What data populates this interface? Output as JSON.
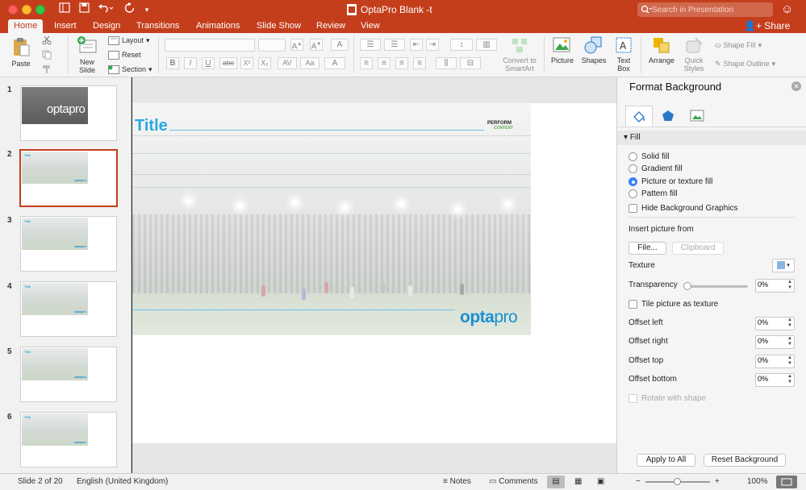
{
  "window": {
    "title": "OptaPro Blank -t",
    "search_placeholder": "Search in Presentation",
    "share_label": "Share"
  },
  "tabs": [
    {
      "label": "Home",
      "active": true
    },
    {
      "label": "Insert"
    },
    {
      "label": "Design"
    },
    {
      "label": "Transitions"
    },
    {
      "label": "Animations"
    },
    {
      "label": "Slide Show"
    },
    {
      "label": "Review"
    },
    {
      "label": "View"
    }
  ],
  "ribbon": {
    "paste": "Paste",
    "new_slide_1": "New",
    "new_slide_2": "Slide",
    "layout": "Layout",
    "reset": "Reset",
    "section": "Section",
    "convert_1": "Convert to",
    "convert_2": "SmartArt",
    "picture": "Picture",
    "shapes": "Shapes",
    "textbox_1": "Text",
    "textbox_2": "Box",
    "arrange": "Arrange",
    "quick_1": "Quick",
    "quick_2": "Styles",
    "shape_fill": "Shape Fill",
    "shape_outline": "Shape Outline",
    "bold": "B",
    "italic": "I",
    "underline": "U",
    "strike": "abc",
    "superscript": "X²",
    "subscript": "X₂"
  },
  "slides": [
    {
      "num": "1"
    },
    {
      "num": "2",
      "selected": true
    },
    {
      "num": "3"
    },
    {
      "num": "4"
    },
    {
      "num": "5"
    },
    {
      "num": "6"
    }
  ],
  "thumb_text": {
    "title": "Title",
    "logo": "optapro"
  },
  "slide": {
    "title": "Title",
    "perform_1": "PERFORM",
    "perform_2": "CONTENT",
    "logo_a": "opta",
    "logo_b": "pro"
  },
  "panel": {
    "title": "Format Background",
    "fill_section": "Fill",
    "fill_options": [
      {
        "label": "Solid fill",
        "checked": false
      },
      {
        "label": "Gradient fill",
        "checked": false
      },
      {
        "label": "Picture or texture fill",
        "checked": true
      },
      {
        "label": "Pattern fill",
        "checked": false
      }
    ],
    "hide_bg_graphics": "Hide Background Graphics",
    "insert_picture_from": "Insert picture from",
    "file_button": "File...",
    "clipboard_button": "Clipboard",
    "texture": "Texture",
    "transparency": "Transparency",
    "transparency_value": "0%",
    "tile_picture": "Tile picture as texture",
    "offsets": [
      {
        "label": "Offset left",
        "value": "0%"
      },
      {
        "label": "Offset right",
        "value": "0%"
      },
      {
        "label": "Offset top",
        "value": "0%"
      },
      {
        "label": "Offset bottom",
        "value": "0%"
      }
    ],
    "rotate_with_shape": "Rotate with shape",
    "apply_all": "Apply to All",
    "reset_background": "Reset Background"
  },
  "status": {
    "slide_info": "Slide 2 of 20",
    "language": "English (United Kingdom)",
    "notes": "Notes",
    "comments": "Comments",
    "zoom": "100%"
  },
  "colors": {
    "accent": "#c43e1c",
    "title_blue": "#29a9df",
    "logo_blue": "#1a8fd0",
    "radio_blue": "#3a80f6"
  }
}
